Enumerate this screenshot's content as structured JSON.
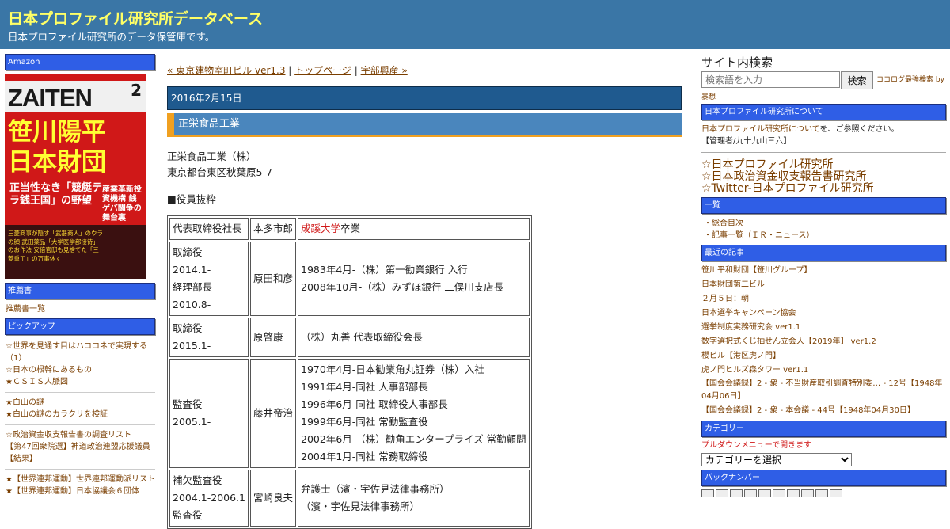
{
  "header": {
    "title": "日本プロファイル研究所データベース",
    "description": "日本プロファイル研究所のデータ保管庫です。",
    "title_color": "#ffff66",
    "bg_color": "#3a76a6"
  },
  "left": {
    "amazon_label": "Amazon",
    "cover": {
      "magazine": "ZAITEN",
      "issue": "2",
      "headline1": "笹川陽平",
      "headline2": "日本財団",
      "subline": "正当性なき「競艇テラ銭王国」の野望",
      "side_text": "産業革新投資機構 銭ゲバ闘争の舞台裏",
      "bottom_text": "三菱商事が隠す「武器商人」のウラの顔 武田薬品「大学医学部接待」のお作法 安倍官邸も見捨てた「三菱重工」の万事休す"
    },
    "recommend_head": "推薦書",
    "recommend_link": "推薦書一覧",
    "pickup_head": "ピックアップ",
    "pickup_groups": [
      [
        "☆世界を見通す目はハココネで実現する（1）",
        "☆日本の根幹にあるもの",
        "★ＣＳＩＳ人脈図"
      ],
      [
        "★白山の謎",
        "★白山の謎のカラクリを検証"
      ],
      [
        "☆政治資金収支報告書の調査リスト",
        "【第47回衆院選】神道政治連盟応援議員【結果】"
      ],
      [
        "★【世界連邦運動】世界連邦運動派リスト",
        "★【世界連邦運動】日本協議会６団体"
      ]
    ]
  },
  "main": {
    "nav": {
      "prev": "« 東京建物室町ビル ver1.3",
      "sep1": " | ",
      "top": "トップページ",
      "sep2": " | ",
      "next": "宇部興産 »"
    },
    "date": "2016年2月15日",
    "post_title": "正栄食品工業",
    "company": "正栄食品工業（株）",
    "address": "東京都台東区秋葉原5-7",
    "section": "■役員抜粋",
    "officers": [
      {
        "role": [
          "代表取締役社長"
        ],
        "name": "本多市郎",
        "notes": [],
        "school": "成蹊大学",
        "school_suffix": "卒業"
      },
      {
        "role": [
          "取締役",
          "2014.1-",
          "経理部長",
          "2010.8-"
        ],
        "name": "原田和彦",
        "notes": [
          "1983年4月-（株）第一勧業銀行 入行",
          "2008年10月-（株）みずほ銀行 二俣川支店長"
        ]
      },
      {
        "role": [
          "取締役",
          "2015.1-"
        ],
        "name": "原啓康",
        "notes": [
          "（株）丸善 代表取締役会長"
        ]
      },
      {
        "role": [
          "監査役",
          "2005.1-"
        ],
        "name": "藤井帝治",
        "notes": [
          "1970年4月-日本勧業角丸証券（株）入社",
          "1991年4月-同社 人事部部長",
          "1996年6月-同社 取締役人事部長",
          "1999年6月-同社 常勤監査役",
          "2002年6月-（株）勧角エンタープライズ 常勤顧問",
          "2004年1月-同社 常務取締役"
        ]
      },
      {
        "role": [
          "補欠監査役",
          "2004.1-2006.1",
          "監査役"
        ],
        "name": "宮崎良夫",
        "notes": [
          "弁護士（濱・宇佐見法律事務所）",
          "（濱・宇佐見法律事務所）"
        ]
      }
    ]
  },
  "right": {
    "search_title": "サイト内検索",
    "search_placeholder": "検索語を入力",
    "search_button": "検索",
    "search_note": "ココログ最強検索 by",
    "search_note2": "暴想",
    "about_head": "日本プロファイル研究所について",
    "about_link": "日本プロファイル研究所について",
    "about_suffix": "を、ご参照ください。",
    "admin": "【管理者/九十九山三六】",
    "big_links": [
      "☆日本プロファイル研究所",
      "☆日本政治資金収支報告書研究所",
      "☆Twitter-日本プロファイル研究所"
    ],
    "list_head": "一覧",
    "list_links": [
      "・総合目次",
      "・記事一覧（ＩＲ・ニュース）"
    ],
    "recent_head": "最近の記事",
    "recent_links": [
      "笹川平和財団【笹川グループ】",
      "日本財団第二ビル",
      "２月５日：朝",
      "日本選挙キャンペーン協会",
      "選挙制度実務研究会 ver1.1",
      "数字選択式くじ抽せん立会人【2019年】 ver1.2",
      "櫻ビル【港区虎ノ門】",
      "虎ノ門ヒルズ森タワー ver1.1",
      "【国会会議録】2 - 衆 - 不当財産取引調査特別委… - 12号【1948年04月06日】",
      "【国会会議録】2 - 衆 - 本会議 - 44号【1948年04月30日】"
    ],
    "category_head": "カテゴリー",
    "category_note": "プルダウンメニューで開きます",
    "category_select": "カテゴリーを選択",
    "backnumber_head": "バックナンバー"
  }
}
